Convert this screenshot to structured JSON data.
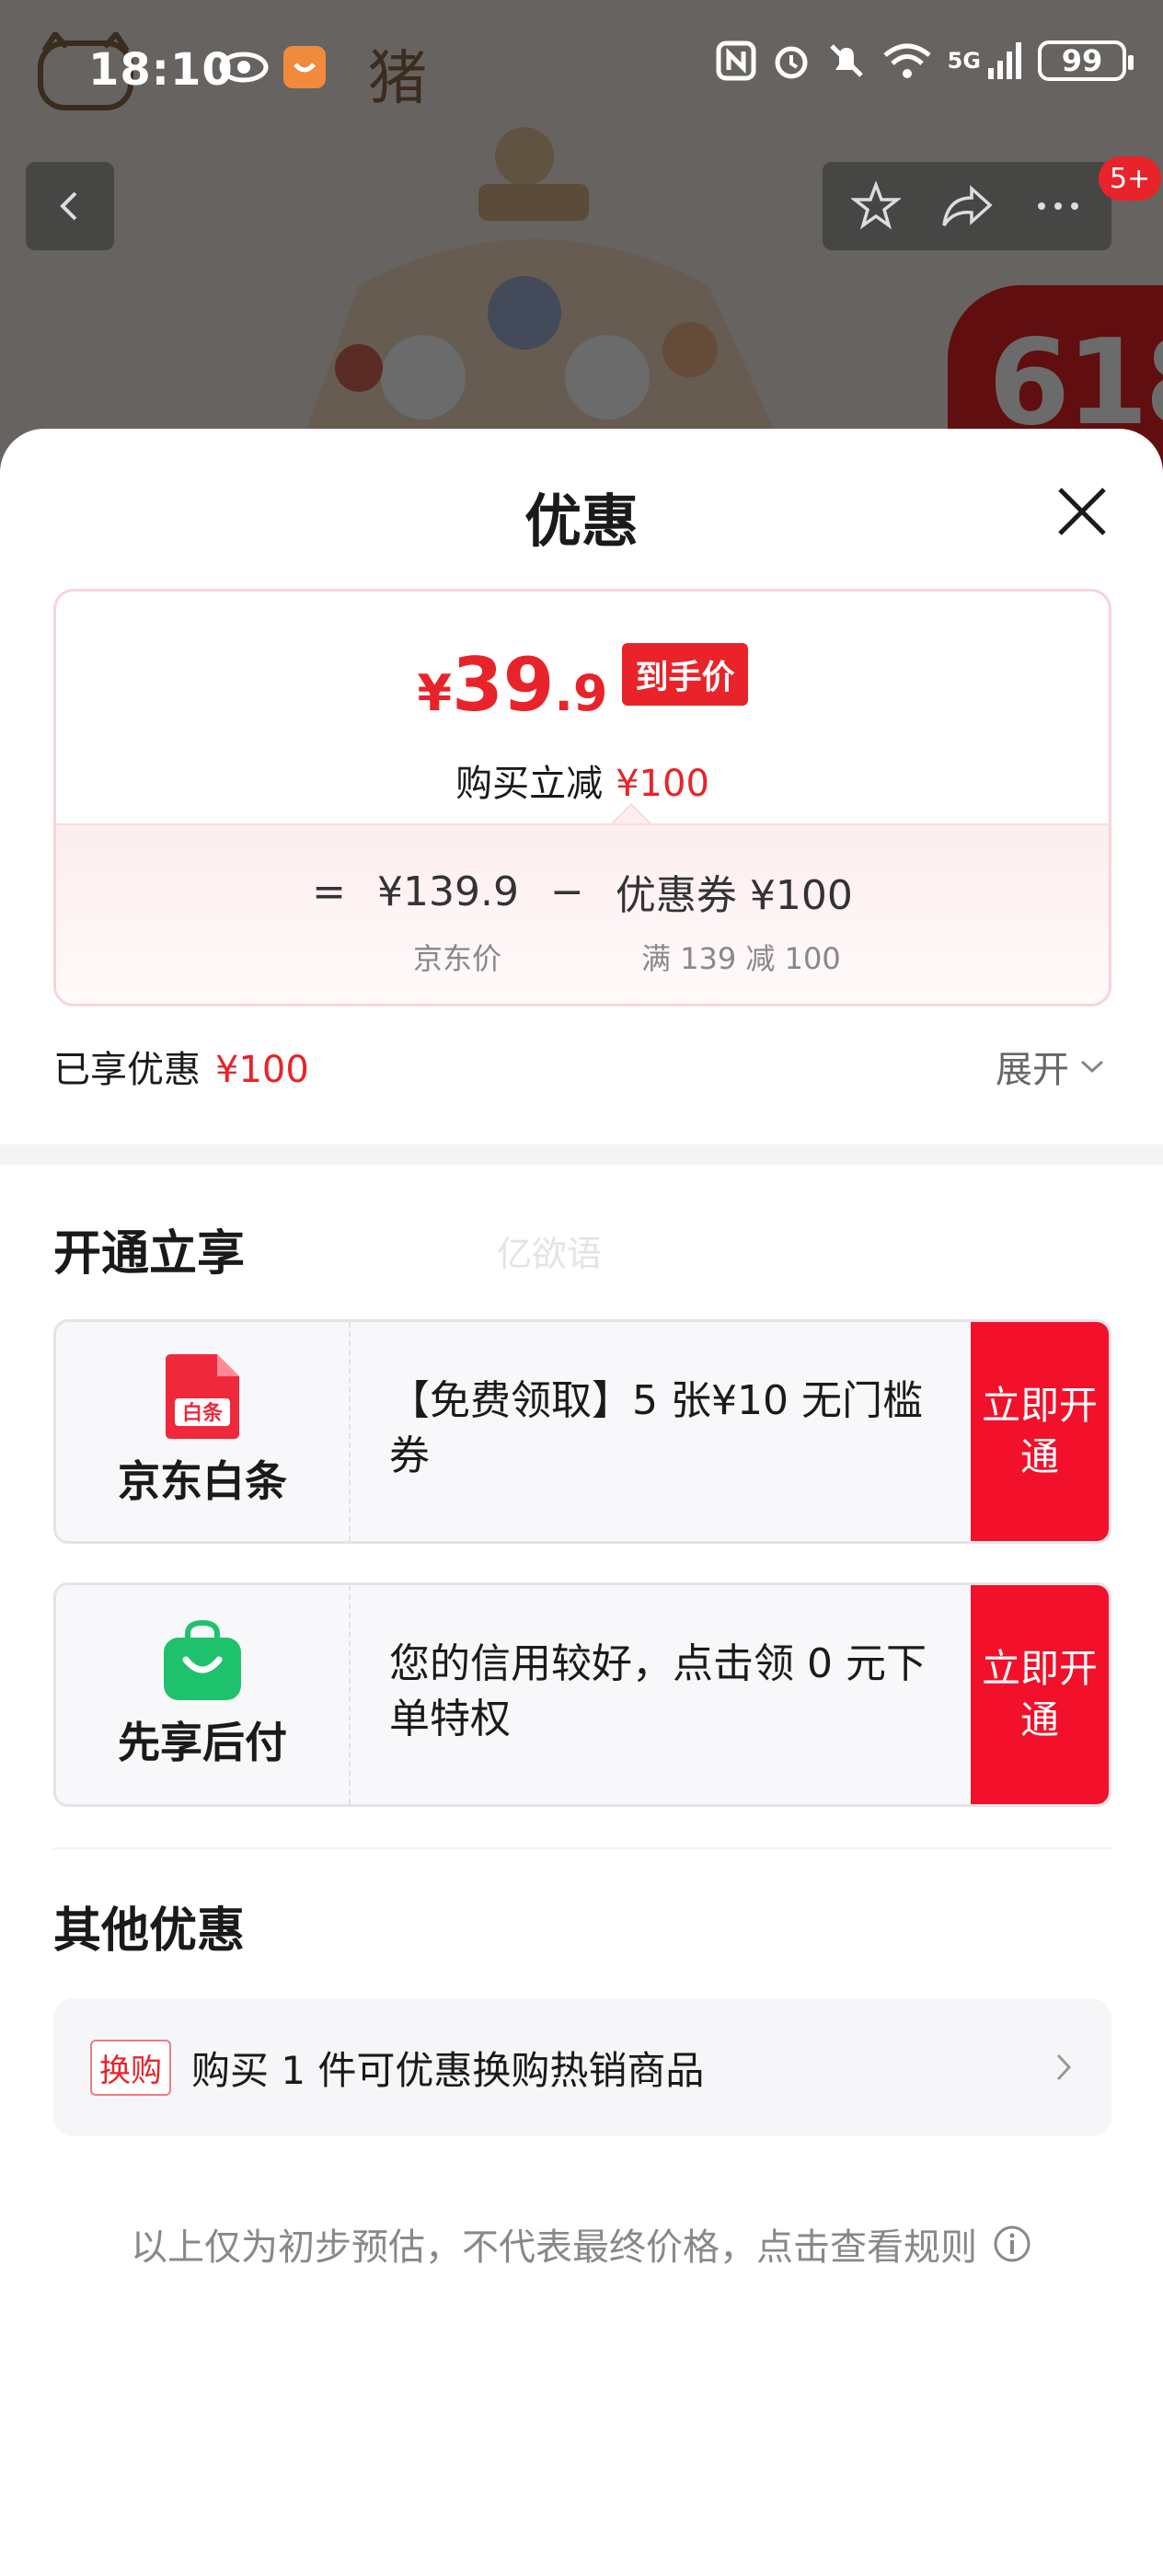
{
  "status_bar": {
    "time": "18:10",
    "battery": "99",
    "network": "5G"
  },
  "background": {
    "logo_text": "猪",
    "banner_text": "618",
    "cart_badge": "5+"
  },
  "sheet": {
    "title": "优惠",
    "price": {
      "yen": "¥",
      "integer": "39",
      "decimal": ".9",
      "tag": "到手价",
      "subtitle": "购买立减",
      "discount": "¥100"
    },
    "formula": {
      "equals": "=",
      "base_price": "¥139.9",
      "minus": "−",
      "coupon_name": "优惠券",
      "coupon_value": "¥100",
      "base_label": "京东价",
      "coupon_label": "满 139 减 100"
    },
    "enjoyed": {
      "label": "已享优惠",
      "value": "¥100"
    },
    "expand_label": "展开",
    "open_section": {
      "title": "开通立享",
      "watermark": "亿欲语",
      "offers": [
        {
          "icon_text": "白条",
          "name": "京东白条",
          "text": "【免费领取】5 张¥10 无门槛券",
          "button": "立即开通"
        },
        {
          "name": "先享后付",
          "text": "您的信用较好，点击领 0 元下单特权",
          "button": "立即开通"
        }
      ]
    },
    "other_section": {
      "title": "其他优惠",
      "items": [
        {
          "tag": "换购",
          "text": "购买 1 件可优惠换购热销商品"
        }
      ]
    },
    "footnote": "以上仅为初步预估，不代表最终价格，点击查看规则"
  },
  "colors": {
    "accent": "#e8232a",
    "button": "#f2102a",
    "green_icon": "#1fc26c"
  }
}
